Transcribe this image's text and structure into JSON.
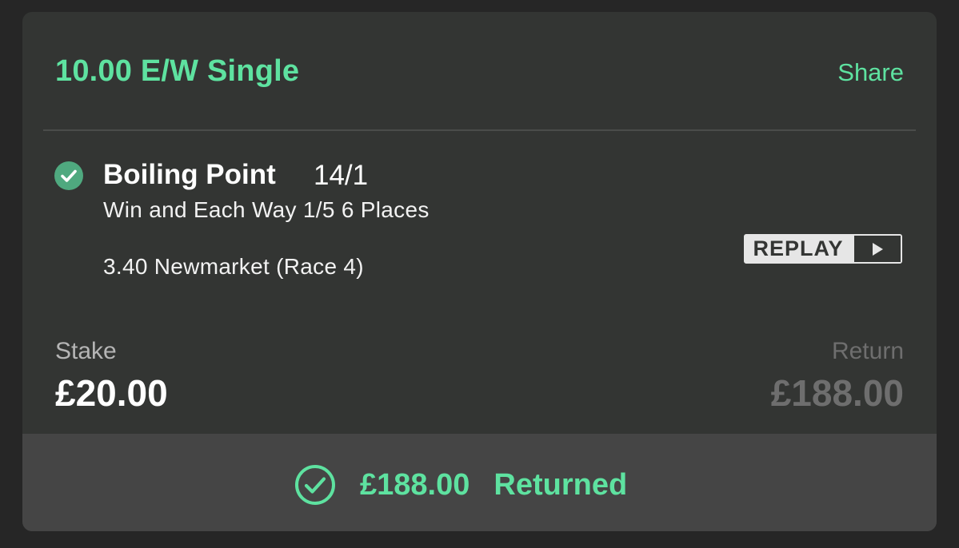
{
  "bet": {
    "title": "10.00 E/W Single",
    "share_label": "Share"
  },
  "selection": {
    "name": "Boiling Point",
    "odds": "14/1",
    "market": "Win and Each Way 1/5 6 Places",
    "event": "3.40 Newmarket (Race 4)",
    "status_icon": "check-circle-icon"
  },
  "replay": {
    "label": "REPLAY",
    "icon": "play-icon"
  },
  "stake": {
    "label": "Stake",
    "value": "£20.00"
  },
  "return": {
    "label": "Return",
    "value": "£188.00"
  },
  "footer": {
    "icon": "check-circle-outline-icon",
    "amount": "£188.00",
    "label": "Returned"
  },
  "colors": {
    "accent": "#5ee2a0",
    "card_bg": "#333533",
    "footer_bg": "#454545",
    "muted": "#6e6e6e"
  }
}
